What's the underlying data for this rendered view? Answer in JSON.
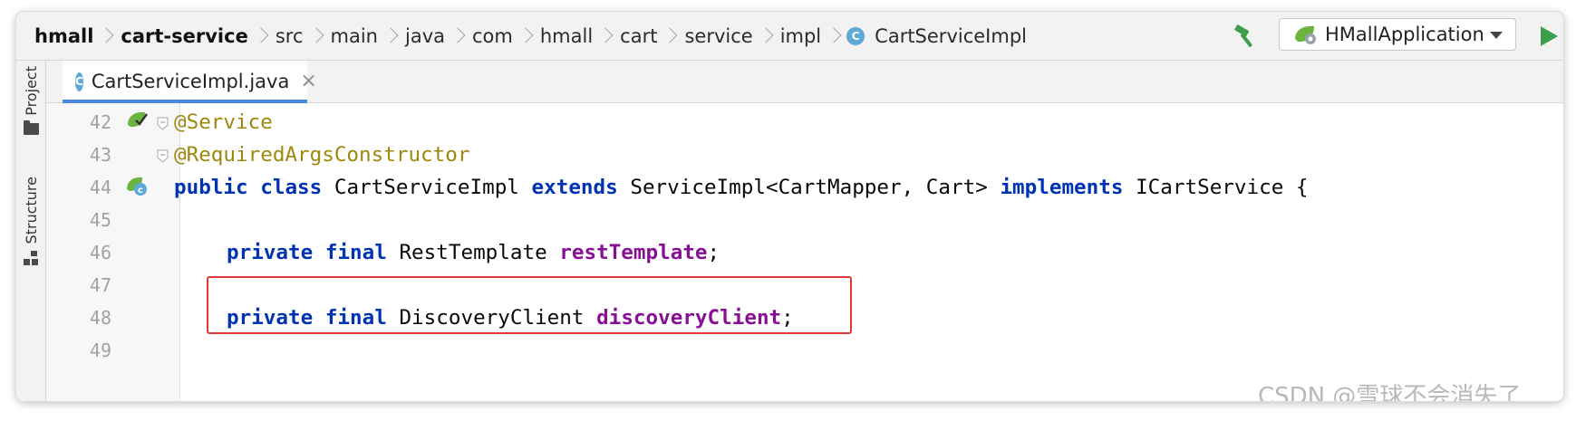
{
  "breadcrumb": {
    "items": [
      {
        "label": "hmall",
        "strong": true
      },
      {
        "label": "cart-service",
        "strong": true
      },
      {
        "label": "src"
      },
      {
        "label": "main"
      },
      {
        "label": "java"
      },
      {
        "label": "com"
      },
      {
        "label": "hmall"
      },
      {
        "label": "cart"
      },
      {
        "label": "service"
      },
      {
        "label": "impl"
      },
      {
        "label": "CartServiceImpl",
        "icon": "class-icon"
      }
    ],
    "class_icon_letter": "C"
  },
  "toolbar": {
    "build_icon": "hammer-icon",
    "run_config_label": "HMallApplication",
    "run_config_icon": "spring-boot-icon",
    "run_icon": "run-icon"
  },
  "toolwindows": {
    "project_label": "Project",
    "structure_label": "Structure"
  },
  "editor": {
    "tab_label": "CartServiceImpl.java",
    "tab_icon_letter": "C",
    "tab_close": "×"
  },
  "code": {
    "line_numbers": [
      "42",
      "43",
      "44",
      "45",
      "46",
      "47",
      "48",
      "49"
    ],
    "line42": "@Service",
    "line43": "@RequiredArgsConstructor",
    "line44": {
      "kw1": "public",
      "kw2": "class",
      "name": "CartServiceImpl",
      "kw3": "extends",
      "type": "ServiceImpl<CartMapper, Cart>",
      "kw4": "implements",
      "iface": "ICartService",
      "brace": "{"
    },
    "line46": {
      "kw1": "private",
      "kw2": "final",
      "type": "RestTemplate",
      "field": "restTemplate",
      "end": ";"
    },
    "line48": {
      "kw1": "private",
      "kw2": "final",
      "type": "DiscoveryClient",
      "field": "discoveryClient",
      "end": ";"
    }
  },
  "colors": {
    "keyword": "#0033b3",
    "annotation": "#9e880d",
    "field": "#871094",
    "highlight": "#e03a3a",
    "tab_underline": "#4a88d9"
  },
  "watermark": "CSDN @雪球不会消失了"
}
